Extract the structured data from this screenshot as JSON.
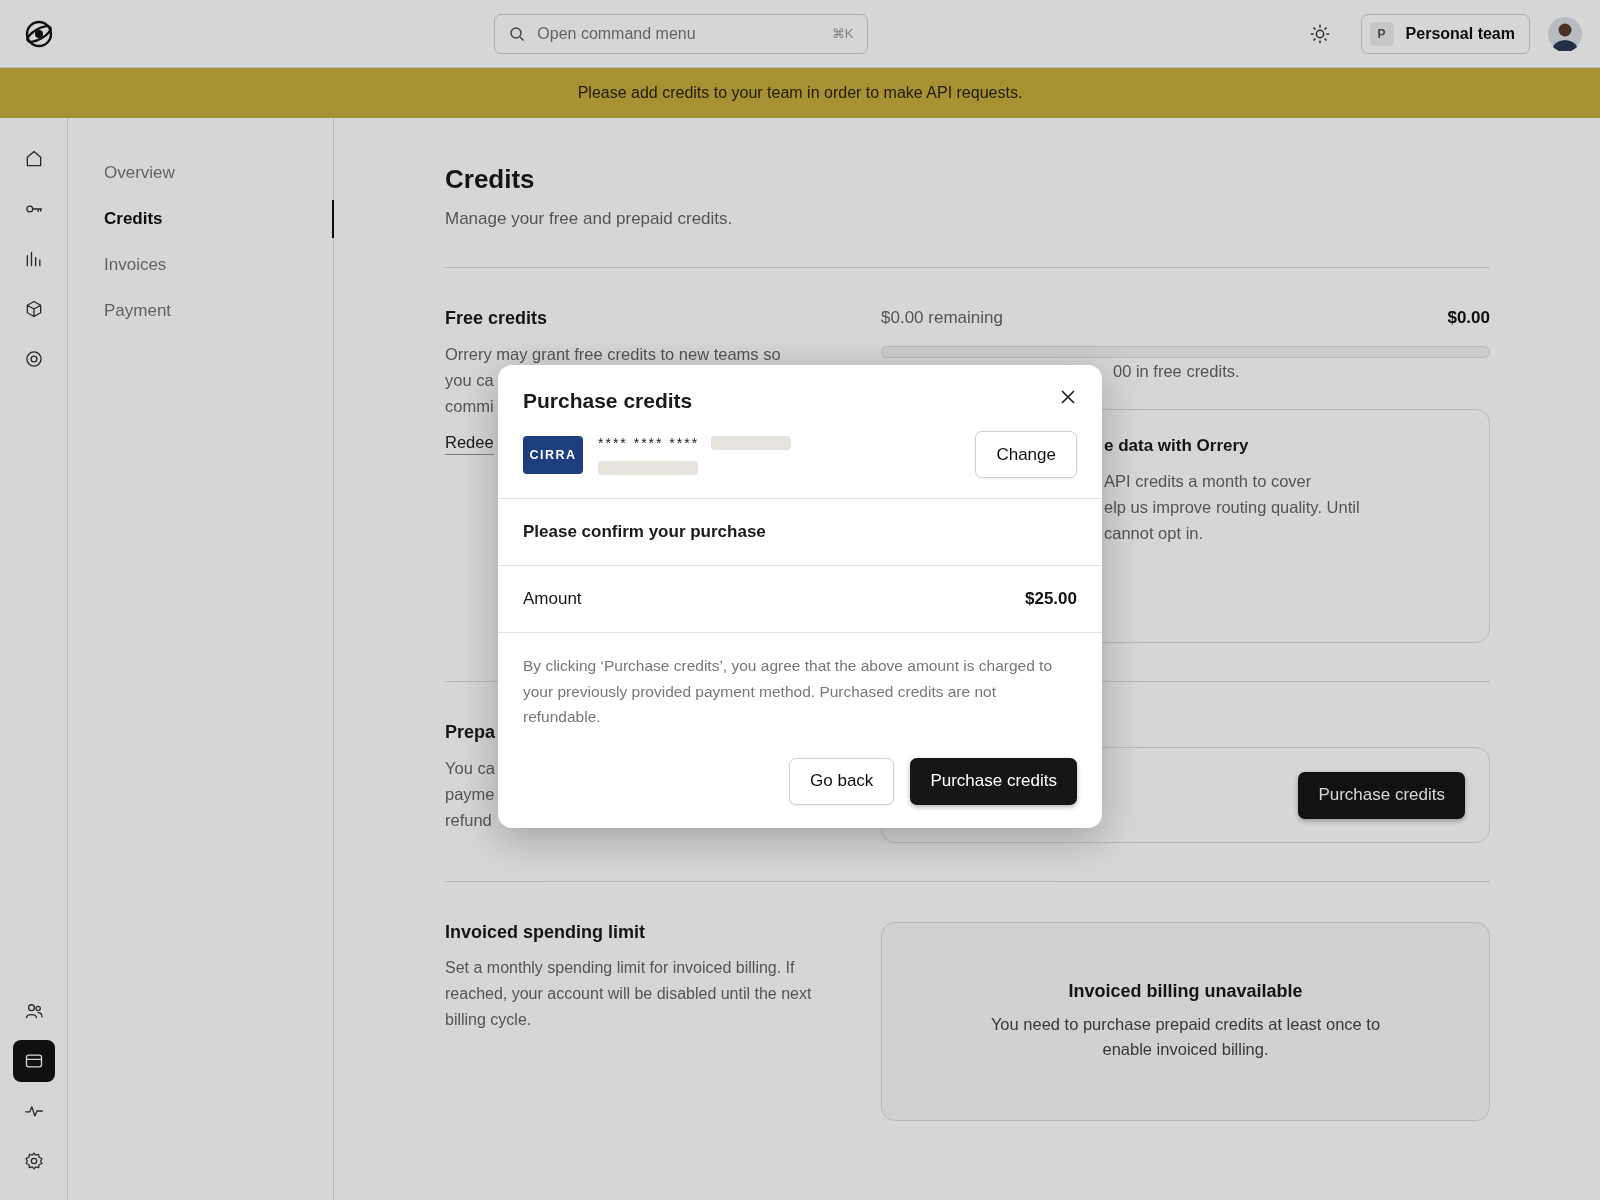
{
  "topbar": {
    "search": {
      "placeholder": "Open command menu",
      "shortcut": "⌘K"
    },
    "team": {
      "initial": "P",
      "name": "Personal team"
    }
  },
  "banner": "Please add credits to your team in order to make API requests.",
  "rail": {
    "top": [
      {
        "selected": false
      },
      {
        "selected": false
      },
      {
        "selected": false
      },
      {
        "selected": false
      },
      {
        "selected": false
      }
    ],
    "bottom": [
      {
        "selected": false
      },
      {
        "selected": true
      },
      {
        "selected": false
      },
      {
        "selected": false
      }
    ]
  },
  "subnav": [
    {
      "label": "Overview",
      "selected": false
    },
    {
      "label": "Credits",
      "selected": true
    },
    {
      "label": "Invoices",
      "selected": false
    },
    {
      "label": "Payment",
      "selected": false
    }
  ],
  "page": {
    "title": "Credits",
    "subtitle": "Manage your free and prepaid credits."
  },
  "free_credits": {
    "title": "Free credits",
    "lines": [
      "Orrery may grant free credits to new teams so",
      "you ca",
      "commi"
    ],
    "link": "Redee",
    "remaining": "$0.00 remaining",
    "amount": "$0.00",
    "usage": "00 in free credits.",
    "card": {
      "title": "e data with Orrery",
      "lines": [
        "API credits a month to cover",
        "elp us improve routing quality. Until",
        "cannot opt in."
      ]
    }
  },
  "prepaid": {
    "title": "Prepa",
    "lines": [
      "You ca",
      "payme",
      "refund"
    ],
    "button": "Purchase credits"
  },
  "invoiced": {
    "title": "Invoiced spending limit",
    "text": "Set a monthly spending limit for invoiced billing. If reached, your account will be disabled until the next billing cycle.",
    "card": {
      "title": "Invoiced billing unavailable",
      "text": "You need to purchase prepaid credits at least once to enable invoiced billing."
    }
  },
  "modal": {
    "title": "Purchase credits",
    "card_brand": "CIRRA",
    "card_mask": "**** **** ****",
    "change": "Change",
    "confirm": "Please confirm your purchase",
    "amount_label": "Amount",
    "amount": "$25.00",
    "notice": "By clicking ‘Purchase credits’, you agree that the above amount is charged to your previously provided payment method. Purchased credits are not refundable.",
    "buttons": [
      {
        "label": "Go back",
        "kind": "secondary"
      },
      {
        "label": "Purchase credits",
        "kind": "primary"
      }
    ]
  }
}
